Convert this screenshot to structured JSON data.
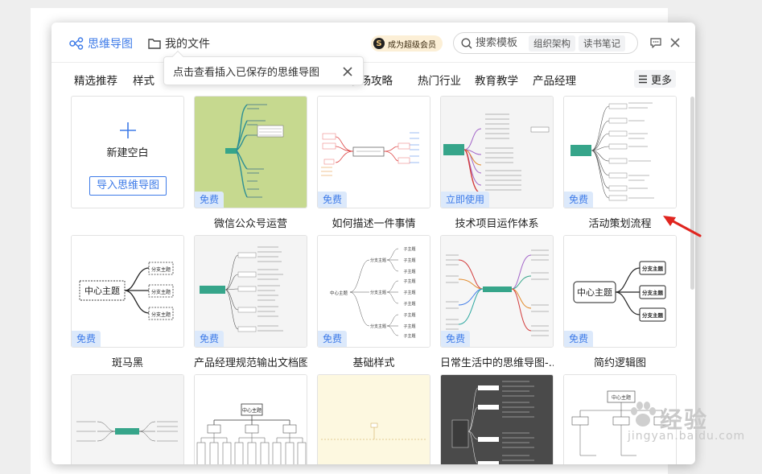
{
  "header": {
    "tab_mindmap": "思维导图",
    "tab_myfiles": "我的文件",
    "vip_badge_letter": "S",
    "vip_label": "成为超级会员",
    "search_placeholder": "搜索模板",
    "search_tags": [
      "组织架构",
      "读书笔记"
    ]
  },
  "tooltip": {
    "text": "点击查看插入已保存的思维导图"
  },
  "categories": [
    "精选推荐",
    "样式",
    "职场攻略",
    "热门行业",
    "教育教学",
    "产品经理"
  ],
  "more_label": "更多",
  "new_card": {
    "label": "新建空白",
    "import_label": "导入思维导图"
  },
  "cards": [
    {
      "title": "微信公众号运营",
      "badge": "免费"
    },
    {
      "title": "如何描述一件事情",
      "badge": "免费"
    },
    {
      "title": "技术项目运作体系",
      "badge": "立即使用"
    },
    {
      "title": "活动策划流程",
      "badge": "免费"
    },
    {
      "title": "斑马黑",
      "badge": "免费"
    },
    {
      "title": "产品经理规范输出文档图",
      "badge": "免费"
    },
    {
      "title": "基础样式",
      "badge": "免费"
    },
    {
      "title": "日常生活中的思维导图-...",
      "badge": "免费"
    },
    {
      "title": "简约逻辑图",
      "badge": "免费"
    },
    {
      "title": "",
      "badge": ""
    },
    {
      "title": "",
      "badge": ""
    },
    {
      "title": "",
      "badge": ""
    },
    {
      "title": "",
      "badge": ""
    },
    {
      "title": "",
      "badge": ""
    }
  ],
  "thumb_text": {
    "center_topic": "中心主题",
    "branch_topic": "分支主题",
    "sub_topic": "子主题",
    "center_short": "中心主题"
  },
  "watermark": {
    "text": "经验",
    "url": "jingyan.baidu.com"
  },
  "colors": {
    "accent": "#3e7be8",
    "badge_bg": "#dce9fb",
    "arrow": "#e0251f",
    "vip_bg": "#fcefd6"
  }
}
